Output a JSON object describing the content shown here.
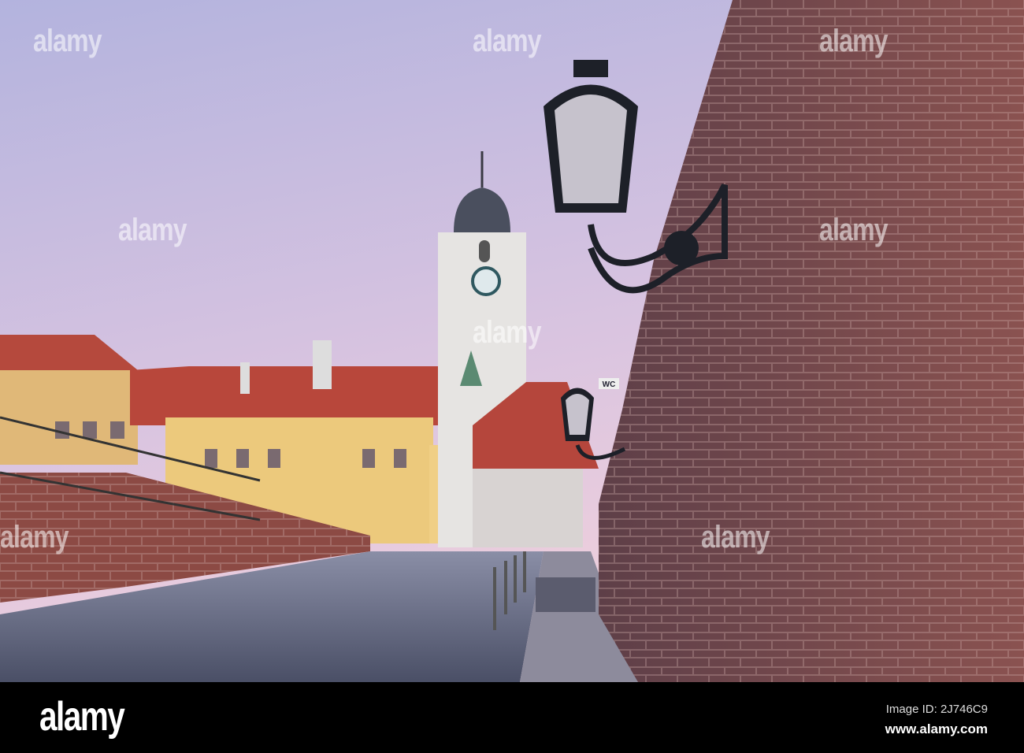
{
  "photo": {
    "subject": "Council Tower and brick wall with street lamps at dawn",
    "sign_wc": "WC",
    "colors": {
      "sky_top": "#aeb0dc",
      "sky_bottom": "#e7c9dc",
      "brick": "#7a4a4a",
      "roof": "#b84a3c",
      "facade": "#e8c77a",
      "tower": "#e4e2de"
    }
  },
  "watermark": {
    "text": "alamy"
  },
  "footer": {
    "logo": "alamy",
    "image_id": "Image ID: 2J746C9",
    "url": "www.alamy.com"
  }
}
